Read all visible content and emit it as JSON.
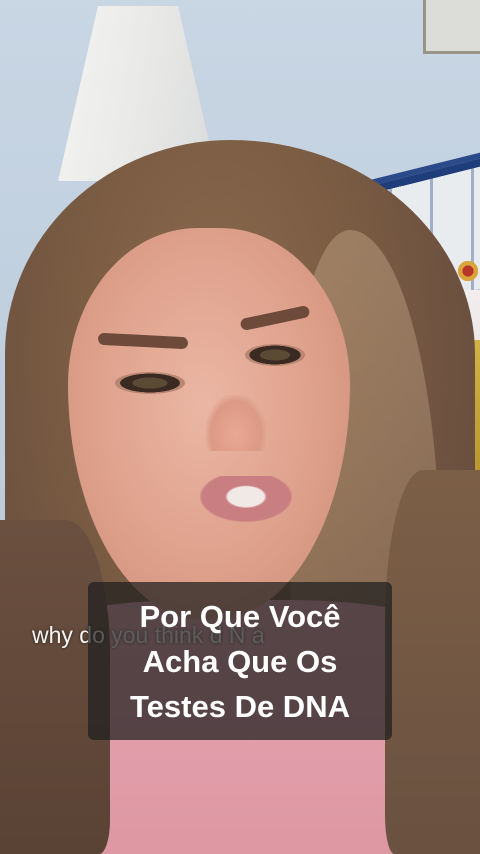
{
  "video": {
    "background_caption": "why do you think d N a",
    "overlay_caption": {
      "lines": [
        "Por Que Você",
        "Acha Que Os",
        "Testes De DNA"
      ]
    }
  },
  "colors": {
    "caption_box": "#1e1e1e",
    "caption_text": "#ffffff",
    "sweater": "#e7a7b2",
    "wall": "#c9d6e4"
  }
}
